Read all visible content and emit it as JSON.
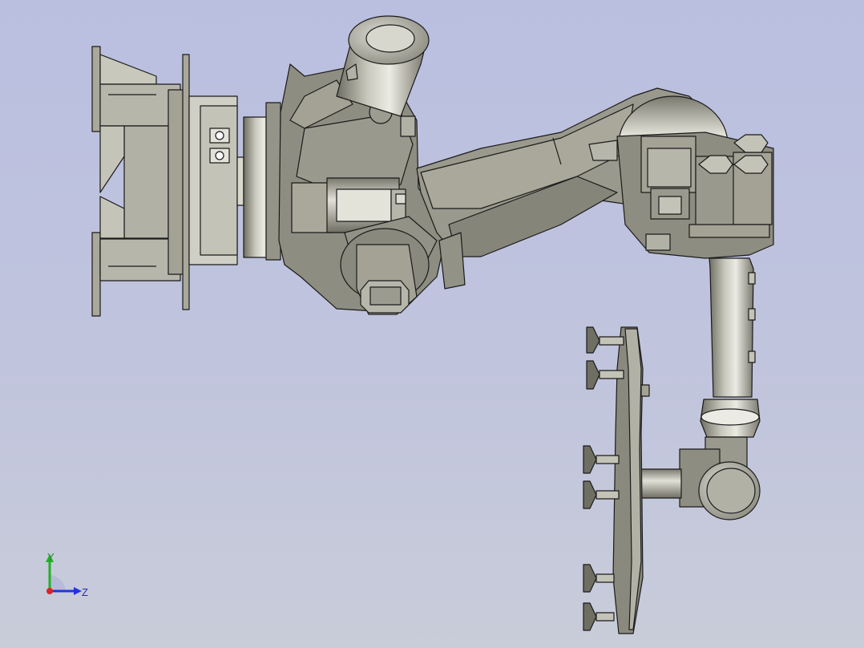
{
  "scene": {
    "background_top": "#babfe0",
    "background_bottom": "#c9ccd9",
    "model_fill": "#a9a89a",
    "model_dark": "#6f6e63",
    "model_light": "#d6d5cb",
    "edge_color": "#1a1a1a"
  },
  "triad": {
    "y_label": "Y",
    "z_label": "Z",
    "y_color": "#22b022",
    "z_color": "#2233dd",
    "x_color": "#dd2222"
  }
}
